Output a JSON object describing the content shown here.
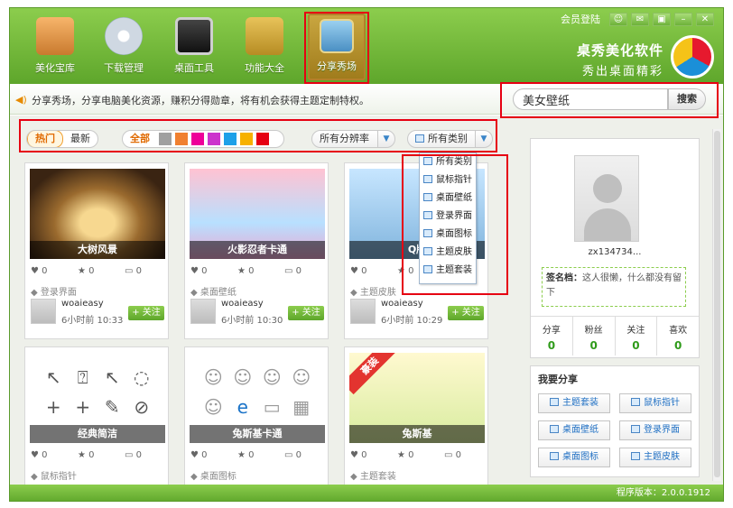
{
  "nav": {
    "items": [
      {
        "label": "美化宝库"
      },
      {
        "label": "下载管理"
      },
      {
        "label": "桌面工具"
      },
      {
        "label": "功能大全"
      },
      {
        "label": "分享秀场"
      }
    ]
  },
  "topbar": {
    "login": "会员登陆"
  },
  "brand": {
    "line1": "桌秀美化软件",
    "line2": "秀出桌面精彩"
  },
  "notice": {
    "text": "分享秀场，分享电脑美化资源，赚积分得勋章，将有机会获得主题定制特权。"
  },
  "search": {
    "value": "美女壁纸",
    "button": "搜索"
  },
  "filters": {
    "hot": "热门",
    "newest": "最新",
    "all": "全部",
    "colors": [
      "#a0a0a0",
      "#f08030",
      "#ee0099",
      "#cc33cc",
      "#1ea0e8",
      "#f7b100",
      "#e60012"
    ],
    "resolution": "所有分辨率",
    "category": "所有类别"
  },
  "category_menu": [
    "所有类别",
    "鼠标指针",
    "桌面壁纸",
    "登录界面",
    "桌面图标",
    "主题皮肤",
    "主题套装"
  ],
  "cards": [
    {
      "caption": "大树风景",
      "likes": "0",
      "stars": "0",
      "comments": "0",
      "tag": "登录界面",
      "user": "woaieasy",
      "time": "6小时前 10:33",
      "follow": "+ 关注"
    },
    {
      "caption": "火影忍者卡通",
      "likes": "0",
      "stars": "0",
      "comments": "0",
      "tag": "桌面壁纸",
      "user": "woaieasy",
      "time": "6小时前 10:30",
      "follow": "+ 关注"
    },
    {
      "caption": "Q版",
      "likes": "0",
      "stars": "0",
      "comments": "0",
      "tag": "主题皮肤",
      "user": "woaieasy",
      "time": "6小时前 10:29",
      "follow": "+ 关注"
    },
    {
      "caption": "经典简洁",
      "likes": "0",
      "stars": "0",
      "comments": "0",
      "tag": "鼠标指针"
    },
    {
      "caption": "兔斯基卡通",
      "likes": "0",
      "stars": "0",
      "comments": "0",
      "tag": "桌面图标"
    },
    {
      "caption": "兔斯基",
      "ribbon": "豪装",
      "likes": "0",
      "stars": "0",
      "comments": "0",
      "tag": "主题套装"
    }
  ],
  "profile": {
    "name": "zx134734...",
    "sig_label": "签名档：",
    "sig_text": "这人很懒，什么都没有留下",
    "stats": [
      {
        "label": "分享",
        "value": "0"
      },
      {
        "label": "粉丝",
        "value": "0"
      },
      {
        "label": "关注",
        "value": "0"
      },
      {
        "label": "喜欢",
        "value": "0"
      }
    ]
  },
  "share": {
    "title": "我要分享",
    "buttons": [
      "主题套装",
      "鼠标指针",
      "桌面壁纸",
      "登录界面",
      "桌面图标",
      "主题皮肤"
    ]
  },
  "status": {
    "version": "程序版本：2.0.0.1912"
  }
}
